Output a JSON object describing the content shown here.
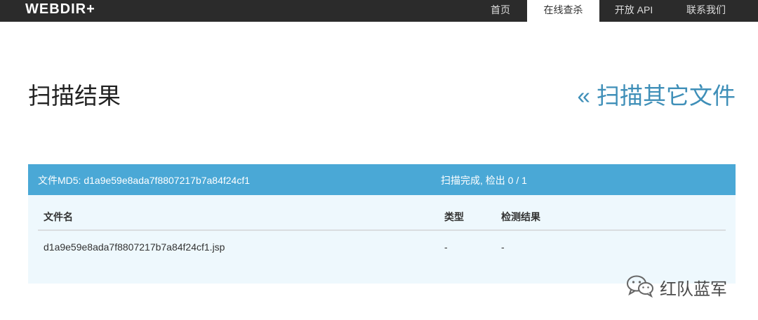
{
  "navbar": {
    "brand": "WEBDIR+",
    "items": [
      {
        "label": "首页",
        "active": false
      },
      {
        "label": "在线查杀",
        "active": true
      },
      {
        "label": "开放 API",
        "active": false
      },
      {
        "label": "联系我们",
        "active": false
      }
    ]
  },
  "page": {
    "title": "扫描结果",
    "scan_other_link": "« 扫描其它文件"
  },
  "result_panel": {
    "md5_text": "文件MD5: d1a9e59e8ada7f8807217b7a84f24cf1",
    "status_text": "扫描完成, 检出 0 / 1",
    "columns": [
      "文件名",
      "类型",
      "检测结果"
    ],
    "rows": [
      {
        "filename": "d1a9e59e8ada7f8807217b7a84f24cf1.jsp",
        "type": "-",
        "result": "-"
      }
    ]
  },
  "watermark": {
    "icon": "wechat-icon",
    "text": "红队蓝军"
  },
  "colors": {
    "navbar_bg": "#2b2b2b",
    "panel_header": "#4aa8d6",
    "panel_body": "#eef8fd",
    "link": "#3f8fb8"
  }
}
